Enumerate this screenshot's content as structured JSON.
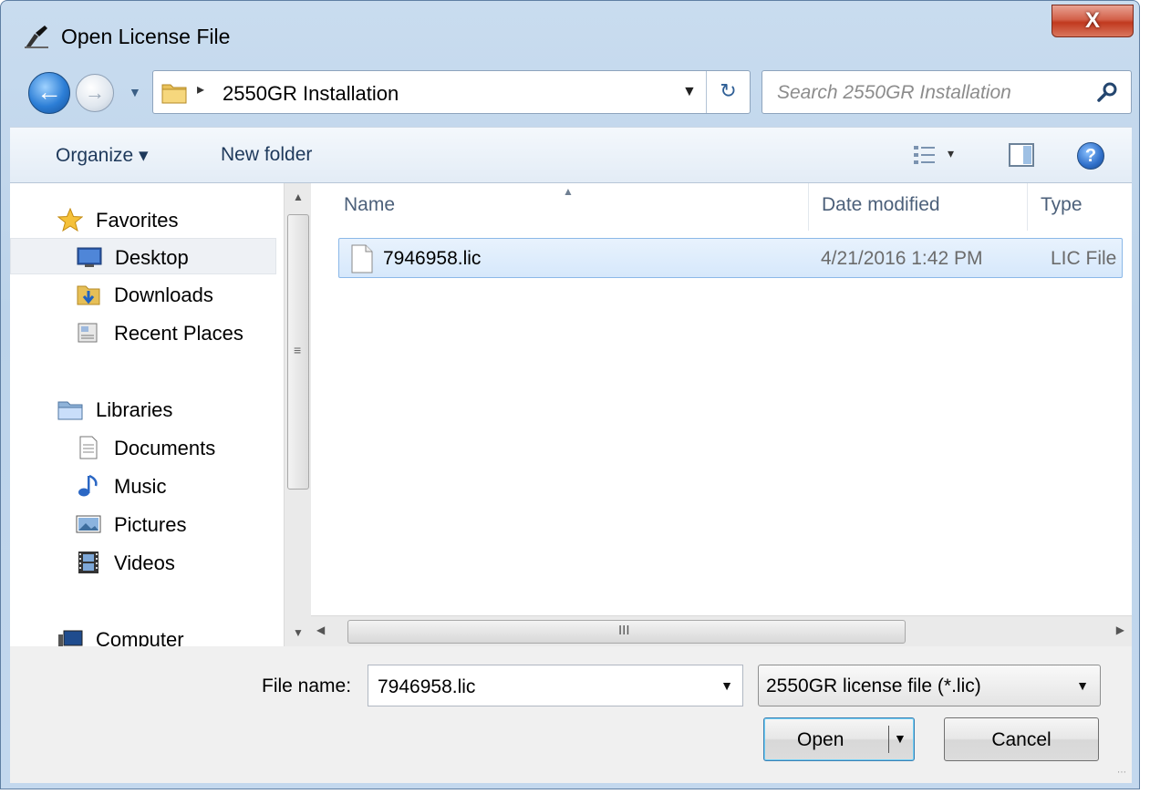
{
  "window": {
    "title": "Open License File",
    "close_label": "X"
  },
  "nav": {
    "back_icon": "back-arrow-icon",
    "forward_icon": "forward-arrow-icon",
    "address": {
      "separator": "▸",
      "path": "2550GR Installation"
    },
    "search": {
      "placeholder": "Search 2550GR Installation"
    }
  },
  "toolbar": {
    "organize_label": "Organize ▾",
    "new_folder_label": "New folder",
    "views_label": "▾",
    "help_label": "?"
  },
  "navpane": {
    "items": [
      {
        "label": "Favorites",
        "icon": "star-icon"
      },
      {
        "label": "Desktop",
        "icon": "desktop-icon"
      },
      {
        "label": "Downloads",
        "icon": "downloads-icon"
      },
      {
        "label": "Recent Places",
        "icon": "recent-places-icon"
      },
      {
        "label": "Libraries",
        "icon": "libraries-icon"
      },
      {
        "label": "Documents",
        "icon": "documents-icon"
      },
      {
        "label": "Music",
        "icon": "music-icon"
      },
      {
        "label": "Pictures",
        "icon": "pictures-icon"
      },
      {
        "label": "Videos",
        "icon": "videos-icon"
      },
      {
        "label": "Computer",
        "icon": "computer-icon"
      }
    ]
  },
  "filelist": {
    "columns": [
      "Name",
      "Date modified",
      "Type"
    ],
    "rows": [
      {
        "name": "7946958.lic",
        "date_modified": "4/21/2016 1:42 PM",
        "type": "LIC File"
      }
    ]
  },
  "scroll": {
    "vgrip": "≡",
    "hgrip": "III",
    "up": "▲",
    "down": "▼",
    "left": "◀",
    "right": "▶"
  },
  "bottom": {
    "file_name_label": "File name:",
    "file_name_value": "7946958.lic",
    "file_type_value": "2550GR license file (*.lic)",
    "open_label": "Open",
    "cancel_label": "Cancel",
    "dropdown_arrow": "▼"
  },
  "colors": {
    "selection_bg": "#d6e8fb",
    "selection_border": "#8bb8e8",
    "close_red": "#c1391f",
    "frame": "#bcd3ea"
  }
}
